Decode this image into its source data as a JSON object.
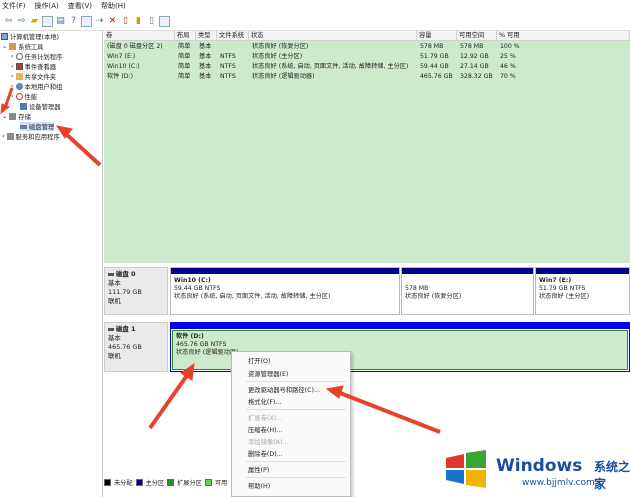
{
  "menubar": {
    "items": [
      "文件(F)",
      "操作(A)",
      "查看(V)",
      "帮助(H)"
    ]
  },
  "tree": {
    "root": "计算机管理(本地)",
    "system_tools": "系统工具",
    "task_scheduler": "任务计划程序",
    "event_viewer": "事件查看器",
    "shared_folders": "共享文件夹",
    "local_users": "本地用户和组",
    "performance": "性能",
    "device_manager": "设备管理器",
    "storage": "存储",
    "disk_management": "磁盘管理",
    "services": "服务和应用程序"
  },
  "volumes": {
    "headers": [
      "卷",
      "布局",
      "类型",
      "文件系统",
      "状态",
      "容量",
      "可用空间",
      "% 可用"
    ],
    "rows": [
      [
        "(磁盘 0 磁盘分区 2)",
        "简单",
        "基本",
        "",
        "状态良好 (恢复分区)",
        "578 MB",
        "578 MB",
        "100 %"
      ],
      [
        "Win7 (E:)",
        "简单",
        "基本",
        "NTFS",
        "状态良好 (主分区)",
        "51.79 GB",
        "12.92 GB",
        "25 %"
      ],
      [
        "Win10 (C:)",
        "简单",
        "基本",
        "NTFS",
        "状态良好 (系统, 启动, 页面文件, 活动, 故障转储, 主分区)",
        "59.44 GB",
        "27.14 GB",
        "46 %"
      ],
      [
        "软件 (D:)",
        "简单",
        "基本",
        "NTFS",
        "状态良好 (逻辑驱动器)",
        "465.76 GB",
        "328.32 GB",
        "70 %"
      ]
    ]
  },
  "disk0": {
    "label": "磁盘 0",
    "type": "基本",
    "size": "111.79 GB",
    "status": "联机",
    "parts": [
      {
        "name": "Win10 (C:)",
        "size": "59.44 GB NTFS",
        "status": "状态良好 (系统, 启动, 页面文件, 活动, 故障转储, 主分区)"
      },
      {
        "name": "",
        "size": "578 MB",
        "status": "状态良好 (恢复分区)"
      },
      {
        "name": "Win7 (E:)",
        "size": "51.79 GB NTFS",
        "status": "状态良好 (主分区)"
      }
    ]
  },
  "disk1": {
    "label": "磁盘 1",
    "type": "基本",
    "size": "465.76 GB",
    "status": "联机",
    "part": {
      "name": "软件 (D:)",
      "size": "465.76 GB NTFS",
      "status": "状态良好 (逻辑驱动器)"
    }
  },
  "context_menu": {
    "open": "打开(O)",
    "explore": "资源管理器(E)",
    "change_letter": "更改驱动器号和路径(C)...",
    "format": "格式化(F)...",
    "extend": "扩展卷(X)...",
    "shrink": "压缩卷(H)...",
    "add_mirror": "添加镜像(A)...",
    "delete": "删除卷(D)...",
    "properties": "属性(P)",
    "help": "帮助(H)"
  },
  "legend": {
    "items": [
      "未分配",
      "主分区",
      "扩展分区",
      "可用"
    ]
  },
  "watermark": {
    "brand": "Windows",
    "cn": "系统之家",
    "url": "www.bjjmlv.com"
  },
  "colors": {
    "volume_bg": "#ccebcc",
    "primary_bar": "#00008b",
    "logical_bar": "#0000ee",
    "arrow": "#e8412c"
  }
}
